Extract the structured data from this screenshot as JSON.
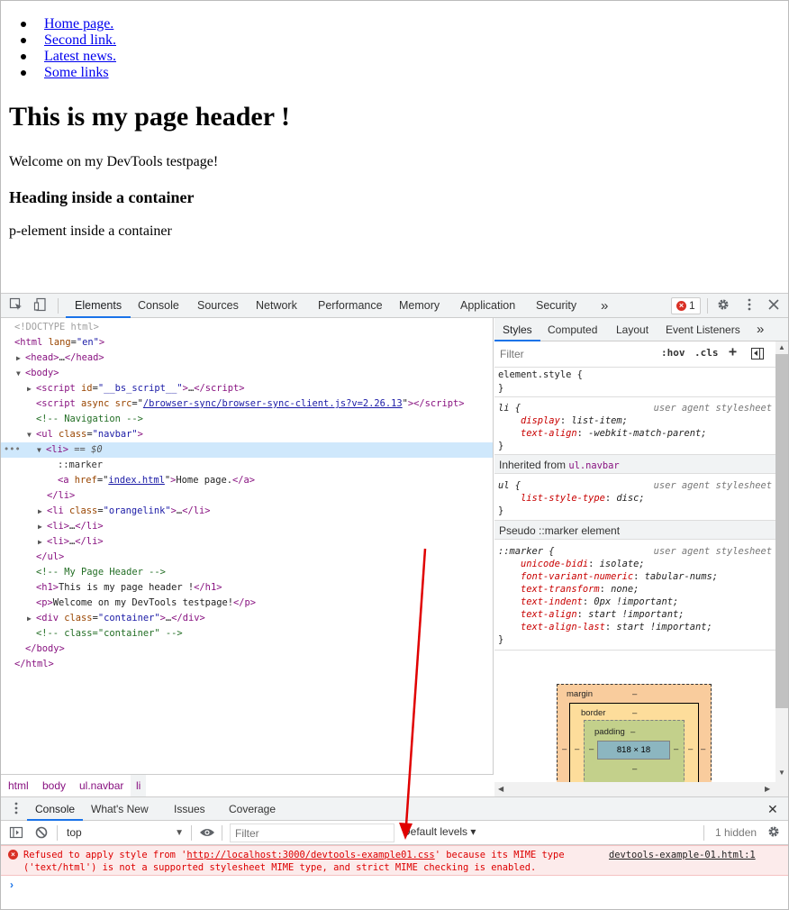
{
  "page": {
    "nav_links": [
      "Home page.",
      "Second link.",
      "Latest news.",
      "Some links"
    ],
    "header": "This is my page header !",
    "welcome": "Welcome on my DevTools testpage!",
    "container_heading": "Heading inside a container",
    "container_paragraph": "p-element inside a container"
  },
  "devtools": {
    "tabs": [
      "Elements",
      "Console",
      "Sources",
      "Network",
      "Performance",
      "Memory",
      "Application",
      "Security"
    ],
    "more_tabs": "»",
    "error_count": "1",
    "active_tab": "Elements"
  },
  "dom": {
    "doctype": "<!DOCTYPE html>",
    "html_open_tag": "html",
    "html_attr": "lang",
    "html_attr_val": "\"en\"",
    "head": "head",
    "body": "body",
    "script1_attr": "id",
    "script1_val": "\"__bs_script__\"",
    "script2_attr": "async src",
    "script2_val": "/browser-sync/browser-sync-client.js?v=2.26.13",
    "comment_nav": "<!-- Navigation -->",
    "ul_attr": "class",
    "ul_val": "\"navbar\"",
    "li_sel_marker": "== $0",
    "marker": "::marker",
    "a_attr": "href",
    "a_val": "index.html",
    "a_text": "Home page.",
    "li2_attr": "class",
    "li2_val": "\"orangelink\"",
    "comment_header": "<!-- My Page Header -->",
    "h1_text": "This is my page header !",
    "p_text": "Welcome on my DevTools testpage!",
    "div_attr": "class",
    "div_val": "\"container\"",
    "comment_container": "<!-- class=\"container\" -->"
  },
  "breadcrumb": [
    "html",
    "body",
    "ul.navbar",
    "li"
  ],
  "styles": {
    "tabs": [
      "Styles",
      "Computed",
      "Layout",
      "Event Listeners"
    ],
    "more": "»",
    "filter_placeholder": "Filter",
    "hov": ":hov",
    "cls": ".cls",
    "plus": "+",
    "element_style": "element.style {",
    "close_brace": "}",
    "li_selector": "li {",
    "ua_source": "user agent stylesheet",
    "li_props": [
      {
        "name": "display",
        "value": "list-item;"
      },
      {
        "name": "text-align",
        "value": "-webkit-match-parent;"
      }
    ],
    "inherited_label": "Inherited from",
    "inherited_from": "ul.navbar",
    "ul_selector": "ul {",
    "ul_props": [
      {
        "name": "list-style-type",
        "value": "disc;"
      }
    ],
    "pseudo_label": "Pseudo ::marker element",
    "marker_selector": "::marker {",
    "marker_props": [
      {
        "name": "unicode-bidi",
        "value": "isolate;"
      },
      {
        "name": "font-variant-numeric",
        "value": "tabular-nums;"
      },
      {
        "name": "text-transform",
        "value": "none;"
      },
      {
        "name": "text-indent",
        "value": "0px !important;"
      },
      {
        "name": "text-align",
        "value": "start !important;"
      },
      {
        "name": "text-align-last",
        "value": "start !important;"
      }
    ]
  },
  "box_model": {
    "margin_label": "margin",
    "border_label": "border",
    "padding_label": "padding",
    "dash": "–",
    "content": "818 × 18"
  },
  "drawer": {
    "tabs": [
      "Console",
      "What's New",
      "Issues",
      "Coverage"
    ],
    "close": "✕",
    "context": "top",
    "filter_placeholder": "Filter",
    "levels": "Default levels ▾",
    "hidden": "1 hidden",
    "message_line1_prefix": "Refused to apply style from '",
    "message_url": "http://localhost:3000/devtools-example01.css",
    "message_line1_suffix": "' because its MIME type",
    "message_line2": "('text/html') is not a supported stylesheet MIME type, and strict MIME checking is enabled.",
    "message_source": "devtools-example-01.html:1",
    "prompt": "›"
  },
  "colors": {
    "accent": "#1a73e8",
    "error": "#d93025",
    "annotation_arrow": "#e00000"
  }
}
